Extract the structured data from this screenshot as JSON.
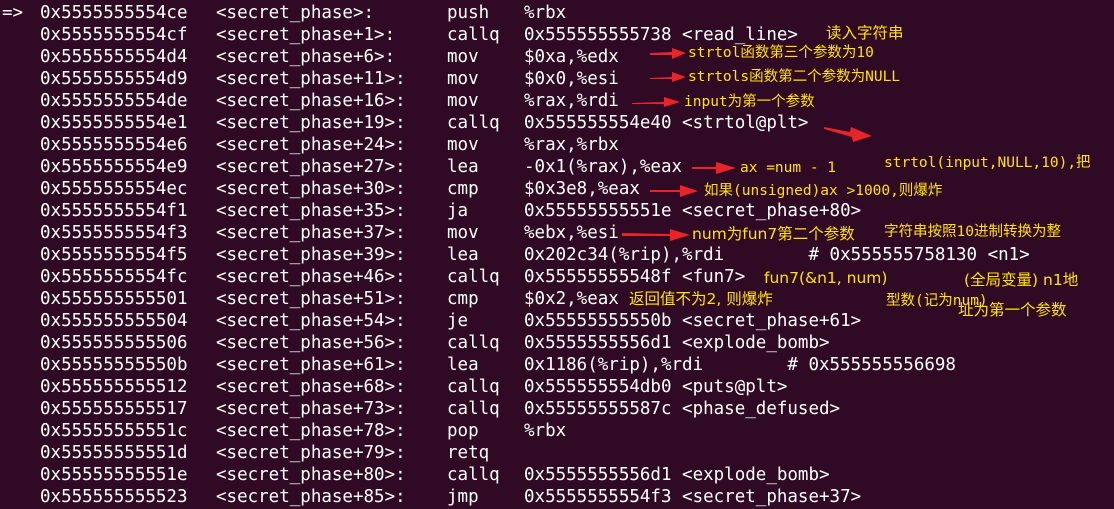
{
  "colors": {
    "background": "#300a24",
    "text": "#ffffff",
    "annotation": "#ffe200",
    "arrow": "#e8232a"
  },
  "instructions": [
    {
      "marker": "=>",
      "addr": "0x5555555554ce",
      "sym": "<secret_phase>:",
      "op": "push",
      "args": "%rbx"
    },
    {
      "marker": "",
      "addr": "0x5555555554cf",
      "sym": "<secret_phase+1>:",
      "op": "callq",
      "args": "0x555555555738 <read_line>"
    },
    {
      "marker": "",
      "addr": "0x5555555554d4",
      "sym": "<secret_phase+6>:",
      "op": "mov",
      "args": "$0xa,%edx"
    },
    {
      "marker": "",
      "addr": "0x5555555554d9",
      "sym": "<secret_phase+11>:",
      "op": "mov",
      "args": "$0x0,%esi"
    },
    {
      "marker": "",
      "addr": "0x5555555554de",
      "sym": "<secret_phase+16>:",
      "op": "mov",
      "args": "%rax,%rdi"
    },
    {
      "marker": "",
      "addr": "0x5555555554e1",
      "sym": "<secret_phase+19>:",
      "op": "callq",
      "args": "0x555555554e40 <strtol@plt>"
    },
    {
      "marker": "",
      "addr": "0x5555555554e6",
      "sym": "<secret_phase+24>:",
      "op": "mov",
      "args": "%rax,%rbx"
    },
    {
      "marker": "",
      "addr": "0x5555555554e9",
      "sym": "<secret_phase+27>:",
      "op": "lea",
      "args": "-0x1(%rax),%eax"
    },
    {
      "marker": "",
      "addr": "0x5555555554ec",
      "sym": "<secret_phase+30>:",
      "op": "cmp",
      "args": "$0x3e8,%eax"
    },
    {
      "marker": "",
      "addr": "0x5555555554f1",
      "sym": "<secret_phase+35>:",
      "op": "ja",
      "args": "0x55555555551e <secret_phase+80>"
    },
    {
      "marker": "",
      "addr": "0x5555555554f3",
      "sym": "<secret_phase+37>:",
      "op": "mov",
      "args": "%ebx,%esi"
    },
    {
      "marker": "",
      "addr": "0x5555555554f5",
      "sym": "<secret_phase+39>:",
      "op": "lea",
      "args": "0x202c34(%rip),%rdi        # 0x555555758130 <n1>"
    },
    {
      "marker": "",
      "addr": "0x5555555554fc",
      "sym": "<secret_phase+46>:",
      "op": "callq",
      "args": "0x55555555548f <fun7>"
    },
    {
      "marker": "",
      "addr": "0x555555555501",
      "sym": "<secret_phase+51>:",
      "op": "cmp",
      "args": "$0x2,%eax"
    },
    {
      "marker": "",
      "addr": "0x555555555504",
      "sym": "<secret_phase+54>:",
      "op": "je",
      "args": "0x55555555550b <secret_phase+61>"
    },
    {
      "marker": "",
      "addr": "0x555555555506",
      "sym": "<secret_phase+56>:",
      "op": "callq",
      "args": "0x5555555556d1 <explode_bomb>"
    },
    {
      "marker": "",
      "addr": "0x55555555550b",
      "sym": "<secret_phase+61>:",
      "op": "lea",
      "args": "0x1186(%rip),%rdi        # 0x555555556698"
    },
    {
      "marker": "",
      "addr": "0x555555555512",
      "sym": "<secret_phase+68>:",
      "op": "callq",
      "args": "0x555555554db0 <puts@plt>"
    },
    {
      "marker": "",
      "addr": "0x555555555517",
      "sym": "<secret_phase+73>:",
      "op": "callq",
      "args": "0x55555555587c <phase_defused>"
    },
    {
      "marker": "",
      "addr": "0x55555555551c",
      "sym": "<secret_phase+78>:",
      "op": "pop",
      "args": "%rbx"
    },
    {
      "marker": "",
      "addr": "0x55555555551d",
      "sym": "<secret_phase+79>:",
      "op": "retq",
      "args": ""
    },
    {
      "marker": "",
      "addr": "0x55555555551e",
      "sym": "<secret_phase+80>:",
      "op": "callq",
      "args": "0x5555555556d1 <explode_bomb>"
    },
    {
      "marker": "",
      "addr": "0x555555555523",
      "sym": "<secret_phase+85>:",
      "op": "jmp",
      "args": "0x5555555554f3 <secret_phase+37>"
    }
  ],
  "annotations": {
    "read_string": "读入字符串",
    "third_param": "strtol函数第三个参数为10",
    "second_param": "strtols函数第二个参数为NULL",
    "first_param": "input为第一个参数",
    "strtol_line1": "strtol(input,NULL,10),把",
    "strtol_line2": "字符串按照10进制转换为整",
    "strtol_line3": "型数(记为num)",
    "ax_num": "ax =num - 1",
    "explode_if": "如果(unsigned)ax >1000,则爆炸",
    "fun7_second": "num为fun7第二个参数",
    "fun7_call": "fun7(&n1, num)",
    "global_line1": "(全局变量) n1地",
    "global_line2": "址为第一个参数",
    "return_check": "返回值不为2, 则爆炸"
  }
}
